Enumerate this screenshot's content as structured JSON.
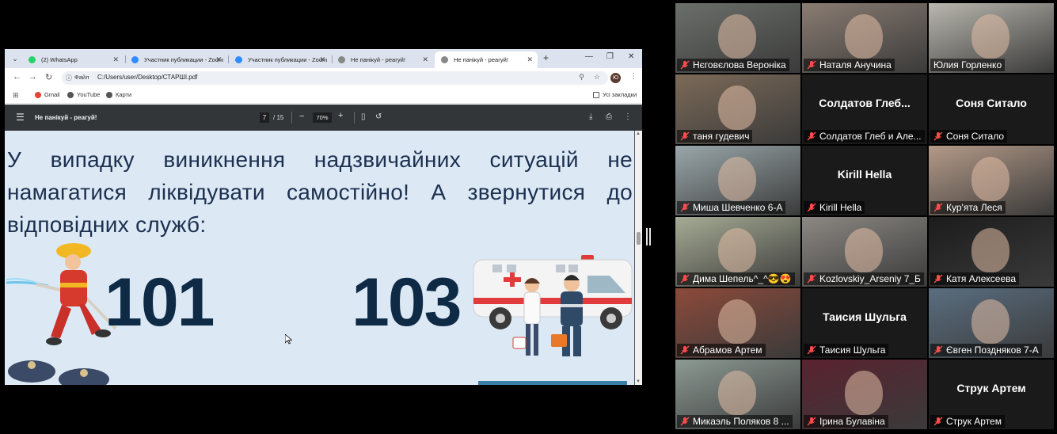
{
  "browser": {
    "tabs": [
      {
        "label": "(2) WhatsApp",
        "fav_color": "#25d366"
      },
      {
        "label": "Участник публикации - Zoom",
        "fav_color": "#2d8cff"
      },
      {
        "label": "Участник публикации - Zoom",
        "fav_color": "#2d8cff"
      },
      {
        "label": "Не панікуй - реагуй!",
        "fav_color": "#888888"
      },
      {
        "label": "Не панікуй - реагуй!",
        "fav_color": "#888888"
      }
    ],
    "address": {
      "scheme_label": "Файл",
      "url": "C:/Users/user/Desktop/СТАРШІ.pdf"
    },
    "profile_initial": "Ю",
    "bookmarks": [
      {
        "label": "Gmail",
        "icon": "gmail-icon",
        "color": "#ea4335"
      },
      {
        "label": "YouTube",
        "icon": "globe-icon",
        "color": "#555555"
      },
      {
        "label": "Карти",
        "icon": "globe-icon",
        "color": "#555555"
      }
    ],
    "all_bookmarks_label": "Усі закладки"
  },
  "pdf": {
    "title": "Не панікуй - реагуй!",
    "current_page": "7",
    "total_pages": "/ 15",
    "zoom": "70%",
    "slide_text": "У випадку виникнення надзвичайних ситуацій не намагатися ліквідувати самостійно! А звернутися до відповідних служб:",
    "numbers": [
      "101",
      "103"
    ]
  },
  "participants": [
    {
      "name": "Нєговєлова Вероніка",
      "video": true,
      "muted": true,
      "bg": "#6b6f6a"
    },
    {
      "name": "Наталя Анучина",
      "video": true,
      "muted": true,
      "bg": "#8a7c72"
    },
    {
      "name": "Юлия Горленко",
      "video": true,
      "muted": false,
      "speaking": true,
      "bg": "#b9b7ae"
    },
    {
      "name": "таня гудевич",
      "video": true,
      "muted": true,
      "bg": "#7c6a58"
    },
    {
      "name": "Солдатов Глеб и Але...",
      "center": "Солдатов  Глеб...",
      "video": false,
      "muted": true
    },
    {
      "name": "Соня Ситало",
      "center": "Соня Ситало",
      "video": false,
      "muted": true
    },
    {
      "name": "Миша Шевченко 6-А",
      "video": true,
      "muted": true,
      "bg": "#9aa7aa"
    },
    {
      "name": "Kirill Hella",
      "center": "Kirill Hella",
      "video": false,
      "muted": true
    },
    {
      "name": "Кур'ята Леся",
      "video": true,
      "muted": true,
      "bg": "#b49a88"
    },
    {
      "name": "Дима Шепель^_^😎😍",
      "video": true,
      "muted": true,
      "bg": "#a6ab94"
    },
    {
      "name": "Kozlovskiy_Arseniy 7_Б",
      "video": true,
      "muted": true,
      "bg": "#8c8883"
    },
    {
      "name": "Катя Алексеева",
      "video": true,
      "muted": true,
      "bg": "#1c1c1c"
    },
    {
      "name": "Абрамов Артем",
      "video": true,
      "muted": true,
      "bg": "#8c4a3a"
    },
    {
      "name": "Таисия Шульга",
      "center": "Таисия Шульга",
      "video": false,
      "muted": true
    },
    {
      "name": "Євген Поздняков 7-А",
      "video": true,
      "muted": true,
      "bg": "#5a6e80"
    },
    {
      "name": "Микаэль Поляков 8 ...",
      "video": true,
      "muted": true,
      "bg": "#8d9a94"
    },
    {
      "name": "Ірина Булавіна",
      "video": true,
      "muted": true,
      "bg": "#5a2230"
    },
    {
      "name": "Струк Артем",
      "center": "Струк Артем",
      "video": false,
      "muted": true
    }
  ]
}
